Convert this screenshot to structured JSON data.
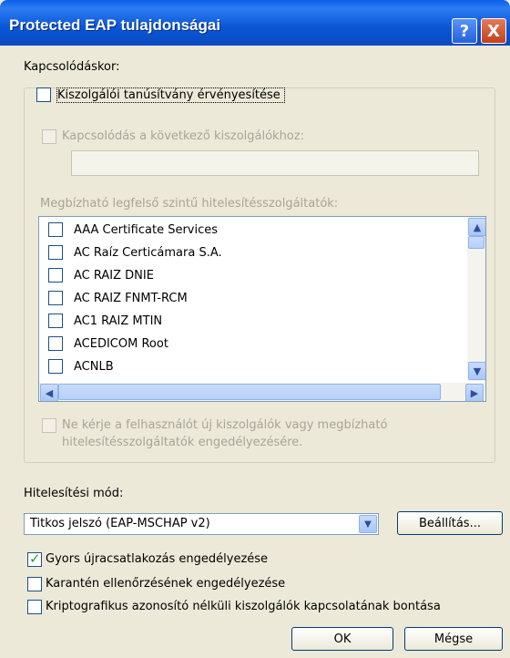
{
  "window": {
    "title": "Protected EAP tulajdonságai",
    "help": "?",
    "close": "X"
  },
  "connect_label": "Kapcsolódáskor:",
  "validate_cert": {
    "label": "Kiszolgálói tanúsítvány érvényesítése",
    "checked": false
  },
  "connect_servers": {
    "label": "Kapcsolódás a következő kiszolgálókhoz:",
    "value": "",
    "disabled": true
  },
  "trusted_ca_label": "Megbízható legfelső szintű hitelesítésszolgáltatók:",
  "ca_list": [
    "AAA Certificate Services",
    "AC Raíz Certicámara S.A.",
    "AC RAIZ DNIE",
    "AC RAIZ FNMT-RCM",
    "AC1 RAIZ MTIN",
    "ACEDICOM Root",
    "ACNLB"
  ],
  "no_prompt": {
    "line1": "Ne kérje a felhasználót új kiszolgálók vagy megbízható",
    "line2": "hitelesítésszolgáltatók engedélyezésére."
  },
  "auth_label": "Hitelesítési mód:",
  "auth_method": "Titkos jelszó (EAP-MSCHAP v2)",
  "settings_button": "Beállítás...",
  "options": [
    {
      "label": "Gyors újracsatlakozás engedélyezése",
      "checked": true
    },
    {
      "label": "Karantén ellenőrzésének engedélyezése",
      "checked": false
    },
    {
      "label": "Kriptografikus azonosító nélküli kiszolgálók kapcsolatának bontása",
      "checked": false
    }
  ],
  "ok_button": "OK",
  "cancel_button": "Mégse"
}
